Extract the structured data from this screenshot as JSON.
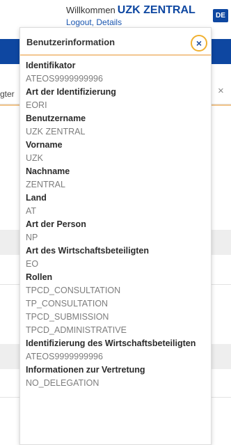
{
  "header": {
    "welcome": "Willkommen",
    "user_name": "UZK ZENTRAL",
    "logout": "Logout",
    "separator": ",",
    "details": "Details",
    "language": "DE"
  },
  "background": {
    "tab_fragment": "gter"
  },
  "panel": {
    "title": "Benutzerinformation",
    "close_symbol": "×",
    "fields": [
      {
        "label": "Identifikator",
        "values": [
          "ATEOS9999999996"
        ]
      },
      {
        "label": "Art der Identifizierung",
        "values": [
          "EORI"
        ]
      },
      {
        "label": "Benutzername",
        "values": [
          "UZK ZENTRAL"
        ]
      },
      {
        "label": "Vorname",
        "values": [
          "UZK"
        ]
      },
      {
        "label": "Nachname",
        "values": [
          "ZENTRAL"
        ]
      },
      {
        "label": "Land",
        "values": [
          "AT"
        ]
      },
      {
        "label": "Art der Person",
        "values": [
          "NP"
        ]
      },
      {
        "label": "Art des Wirtschaftsbeteiligten",
        "values": [
          "EO"
        ]
      },
      {
        "label": "Rollen",
        "values": [
          "TPCD_CONSULTATION",
          "TP_CONSULTATION",
          "TPCD_SUBMISSION",
          "TPCD_ADMINISTRATIVE"
        ]
      },
      {
        "label": "Identifizierung des Wirtschaftsbeteiligten",
        "values": [
          "ATEOS9999999996"
        ]
      },
      {
        "label": "Informationen zur Vertretung",
        "values": [
          "NO_DELEGATION"
        ]
      }
    ]
  }
}
